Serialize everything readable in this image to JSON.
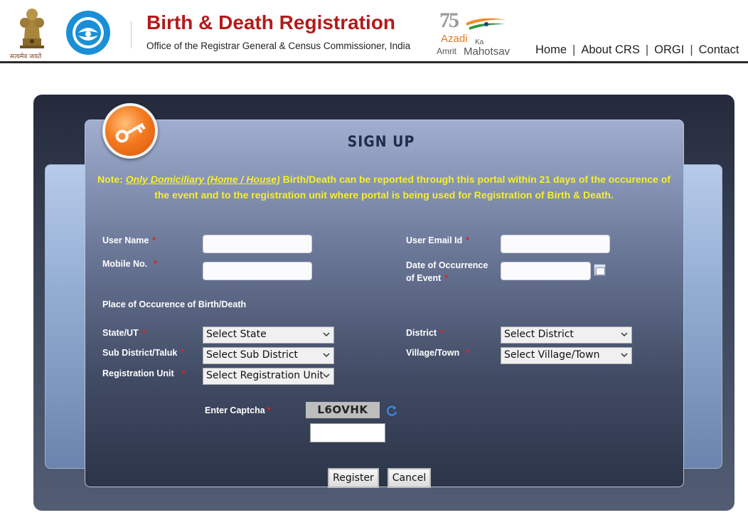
{
  "header": {
    "emblem_motto": "सत्यमेव जयते",
    "title": "Birth & Death Registration",
    "subtitle": "Office of the Registrar General & Census Commissioner, India",
    "azadi": {
      "number": "75",
      "line1": "Azadi",
      "ka": "Ka",
      "amrit": "Amrit",
      "mahotsav": "Mahotsav"
    },
    "nav": [
      {
        "label": "Home"
      },
      {
        "label": "About CRS"
      },
      {
        "label": "ORGI"
      },
      {
        "label": "Contact"
      }
    ],
    "nav_separator": "|"
  },
  "form": {
    "title": "SIGN UP",
    "note": {
      "prefix": "Note: ",
      "emphasis": "Only Domiciliary (Home / House)",
      "rest": " Birth/Death can be reported through this portal within 21 days of the occurence of the event and to the registration unit where portal is being used for Registration of Birth & Death."
    },
    "required_mark": "*",
    "user_name_label": "User Name",
    "user_email_label": "User Email Id",
    "mobile_label": "Mobile No.",
    "date_label_line1": "Date of Occurrence",
    "date_label_line2": "of Event",
    "place_heading": "Place of Occurence of Birth/Death",
    "state_label": "State/UT",
    "state_value": "Select State",
    "district_label": "District",
    "district_value": "Select District",
    "subdistrict_label": "Sub District/Taluk",
    "subdistrict_value": "Select Sub District",
    "village_label": "Village/Town",
    "village_value": "Select Village/Town",
    "regunit_label": "Registration Unit",
    "regunit_value": "Select Registration Unit",
    "captcha_label": "Enter Captcha",
    "captcha_text": "L6OVHK",
    "register_label": "Register",
    "cancel_label": "Cancel"
  },
  "colors": {
    "title_red": "#b31b1b",
    "note_yellow": "#f5ef2b",
    "required_red": "#e0251d",
    "key_orange": "#f47a1f"
  }
}
